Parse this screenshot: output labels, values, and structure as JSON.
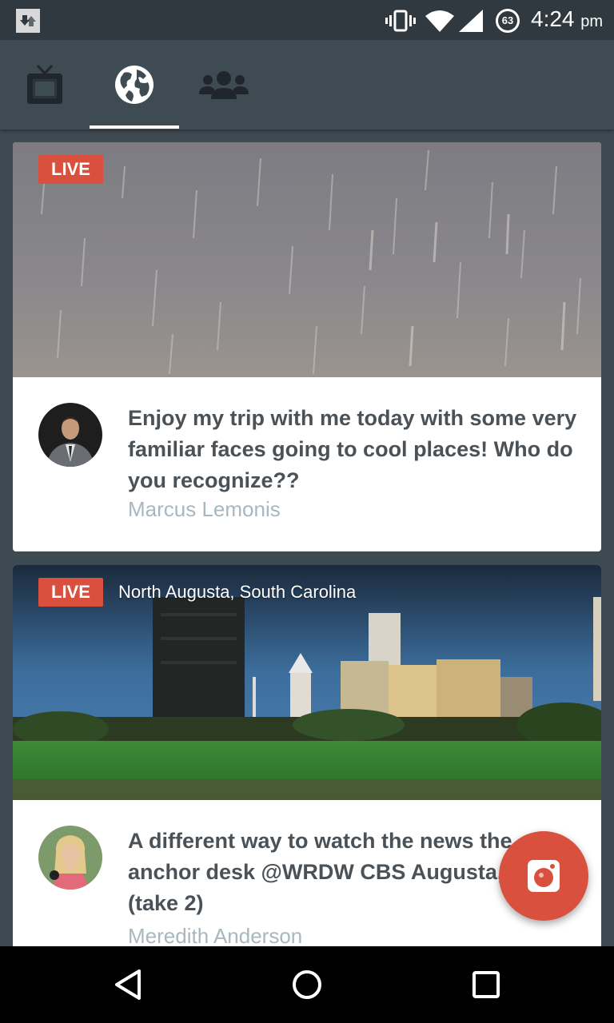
{
  "status_bar": {
    "battery_level": "63",
    "time": "4:24",
    "ampm": "pm",
    "icons": [
      "download-icon",
      "vibrate-icon",
      "wifi-icon",
      "signal-icon",
      "battery-icon"
    ]
  },
  "tabs": [
    {
      "icon": "tv-icon",
      "active": false
    },
    {
      "icon": "globe-icon",
      "active": true
    },
    {
      "icon": "people-icon",
      "active": false
    }
  ],
  "feed": {
    "cards": [
      {
        "badge": "LIVE",
        "location": "",
        "title": "Enjoy my trip with me today with some very familiar faces going to cool places! Who do you recognize??",
        "author": "Marcus Lemonis"
      },
      {
        "badge": "LIVE",
        "location": "North Augusta, South Carolina",
        "title": "A different way to watch the news the anchor desk @WRDW CBS Augusta, GA (take 2)",
        "author": "Meredith Anderson"
      }
    ]
  },
  "fab": {
    "icon": "camera-icon"
  },
  "nav": {
    "icons": [
      "back-icon",
      "home-icon",
      "recent-apps-icon"
    ]
  },
  "colors": {
    "accent": "#d9503f",
    "toolbar": "#3f4b53",
    "background": "#3e4a52",
    "title_text": "#4a5258",
    "author_text": "#a9b7bf"
  }
}
